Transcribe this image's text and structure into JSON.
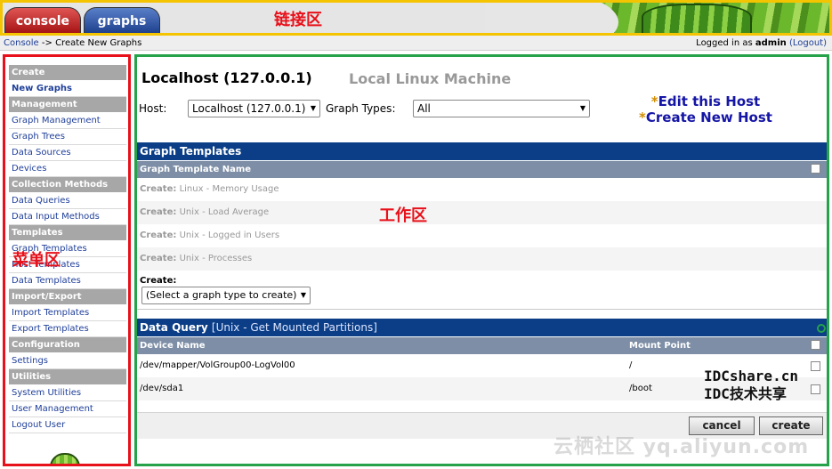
{
  "tabs": [
    {
      "label": "console"
    },
    {
      "label": "graphs"
    }
  ],
  "annotations": {
    "link_zone": "链接区",
    "menu_zone": "菜单区",
    "work_zone": "工作区"
  },
  "breadcrumb": {
    "console": "Console",
    "separator": "->",
    "current": "Create New Graphs"
  },
  "login": {
    "prefix": "Logged in as",
    "user": "admin",
    "logout": "(Logout)"
  },
  "sidebar": {
    "sections": [
      {
        "title": "Create",
        "items": [
          {
            "label": "New Graphs",
            "active": true
          }
        ]
      },
      {
        "title": "Management",
        "items": [
          {
            "label": "Graph Management"
          },
          {
            "label": "Graph Trees"
          },
          {
            "label": "Data Sources"
          },
          {
            "label": "Devices"
          }
        ]
      },
      {
        "title": "Collection Methods",
        "items": [
          {
            "label": "Data Queries"
          },
          {
            "label": "Data Input Methods"
          }
        ]
      },
      {
        "title": "Templates",
        "items": [
          {
            "label": "Graph Templates"
          },
          {
            "label": "Host Templates"
          },
          {
            "label": "Data Templates"
          }
        ]
      },
      {
        "title": "Import/Export",
        "items": [
          {
            "label": "Import Templates"
          },
          {
            "label": "Export Templates"
          }
        ]
      },
      {
        "title": "Configuration",
        "items": [
          {
            "label": "Settings"
          }
        ]
      },
      {
        "title": "Utilities",
        "items": [
          {
            "label": "System Utilities"
          },
          {
            "label": "User Management"
          },
          {
            "label": "Logout User"
          }
        ]
      }
    ]
  },
  "main": {
    "host_title": "Localhost (127.0.0.1)",
    "host_description": "Local Linux Machine",
    "host_label": "Host:",
    "host_value": "Localhost (127.0.0.1)",
    "graph_types_label": "Graph Types:",
    "graph_types_value": "All",
    "edit_host": "Edit this Host",
    "create_host": "Create New Host",
    "star": "*",
    "graph_templates_title": "Graph Templates",
    "graph_template_col": "Graph Template Name",
    "templates": [
      {
        "prefix": "Create:",
        "name": "Linux - Memory Usage"
      },
      {
        "prefix": "Create:",
        "name": "Unix - Load Average"
      },
      {
        "prefix": "Create:",
        "name": "Unix - Logged in Users"
      },
      {
        "prefix": "Create:",
        "name": "Unix - Processes"
      }
    ],
    "create_label": "Create:",
    "create_select": "(Select a graph type to create)",
    "data_query_title": "Data Query",
    "data_query_name": "[Unix - Get Mounted Partitions]",
    "device_col": "Device Name",
    "mount_col": "Mount Point",
    "rows": [
      {
        "device": "/dev/mapper/VolGroup00-LogVol00",
        "mount": "/"
      },
      {
        "device": "/dev/sda1",
        "mount": "/boot"
      }
    ],
    "cancel": "cancel",
    "create": "create"
  },
  "watermarks": {
    "idc_line1": "IDCshare.cn",
    "idc_line2": "IDC技术共享",
    "yunqi": "云栖社区 yq.aliyun.com"
  },
  "colors": {
    "section_header": "#0b3e86",
    "column_header": "#7d8ea6",
    "sidebar_border": "#e8101a",
    "workarea_border": "#25a24a",
    "top_border": "#f5c400"
  }
}
